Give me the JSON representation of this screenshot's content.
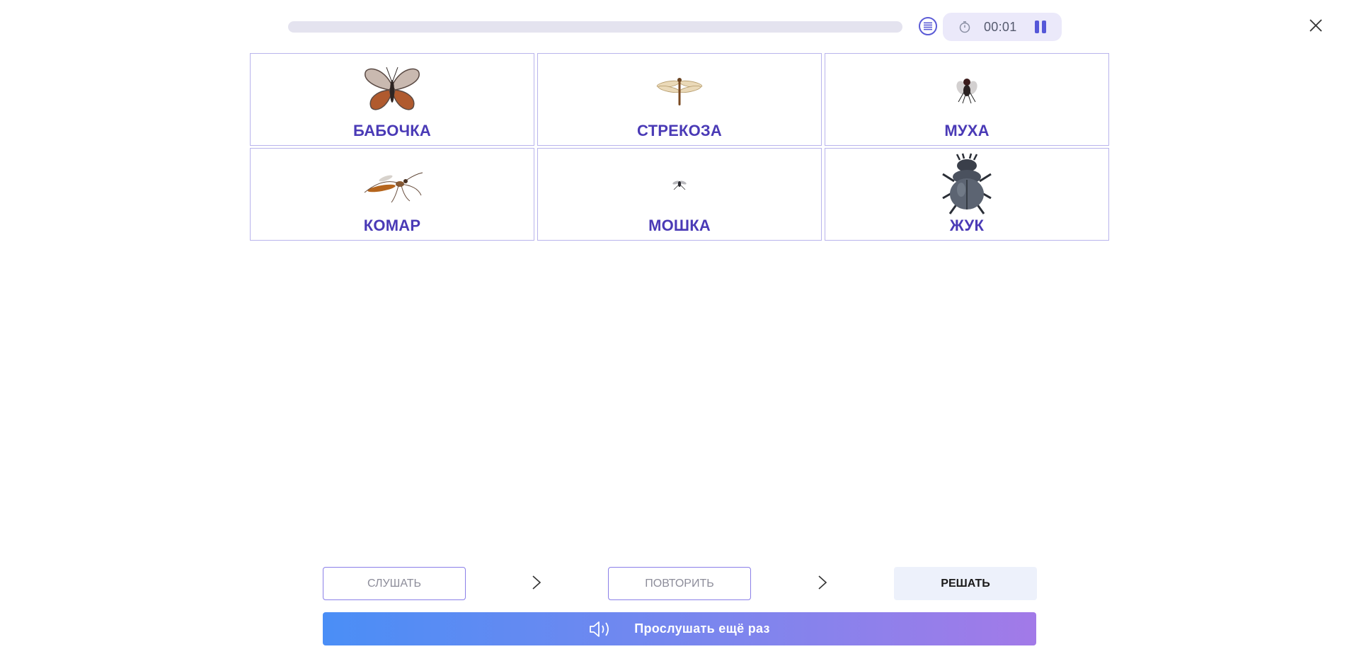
{
  "header": {
    "progress_fraction": 0.0,
    "timer": "00:01",
    "icons": {
      "menu": "list-menu-icon",
      "timer": "stopwatch-icon",
      "pause": "pause-icon",
      "close": "close-icon"
    }
  },
  "cards": [
    {
      "label": "БАБОЧКА",
      "image": "butterfly"
    },
    {
      "label": "СТРЕКОЗА",
      "image": "dragonfly"
    },
    {
      "label": "МУХА",
      "image": "fly"
    },
    {
      "label": "КОМАР",
      "image": "mosquito"
    },
    {
      "label": "МОШКА",
      "image": "gnat"
    },
    {
      "label": "ЖУК",
      "image": "beetle"
    }
  ],
  "steps": {
    "listen": "СЛУШАТЬ",
    "repeat": "ПОВТОРИТЬ",
    "solve": "РЕШАТЬ"
  },
  "listen_again": {
    "label": "Прослушать ещё раз",
    "icon": "speaker-icon"
  },
  "colors": {
    "accent": "#4a3ab6",
    "card_border": "#b9b4ec",
    "gradient_start": "#4a8ef6",
    "gradient_end": "#a27ae8"
  }
}
